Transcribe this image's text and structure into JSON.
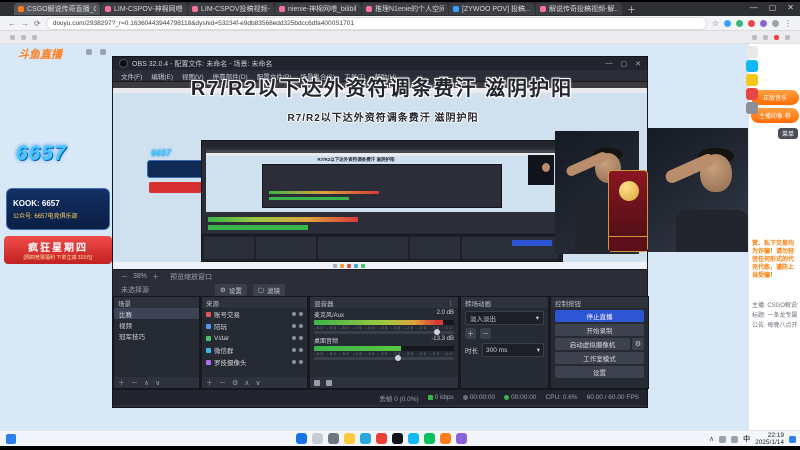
{
  "colors": {
    "douyu_orange": "#ff7c19",
    "bilibili_pink": "#fb7299",
    "tab_blue": "#3aa0ff",
    "obs_bg": "#2b2e38",
    "accent_blue": "#2e55d4",
    "banner_red": "#e23b3b",
    "meter_green": "#3bb54a",
    "meter_red": "#d83a3a",
    "page_blue": "#d9e8f6"
  },
  "icons": {
    "minimize": "—",
    "maximize": "▢",
    "close": "✕",
    "back": "←",
    "forward": "→",
    "reload": "⟳",
    "star": "☆",
    "more": "⋮",
    "caret": "▾",
    "plus": "＋",
    "minus": "－",
    "up": "∧",
    "down": "∨",
    "gear": "⚙"
  },
  "browser": {
    "tabs": [
      {
        "label": "CSGO解说传奇直播_CS...",
        "color": "#ff7c19"
      },
      {
        "label": "LIM-CSPOV-神棉网喂-L...",
        "color": "#fb7299"
      },
      {
        "label": "LIM-CSPOV投稿视频-L...",
        "color": "#fb7299"
      },
      {
        "label": "nienie-神棉网喂_bilibili",
        "color": "#fb7299"
      },
      {
        "label": "推理N1enie的个人空间...",
        "color": "#fb7299"
      },
      {
        "label": "[ZYWOO POV] 投稿...",
        "color": "#3aa0ff"
      },
      {
        "label": "解说传奇投稿视频-解...",
        "color": "#fb7299"
      }
    ],
    "url": "douyu.com/2938297?_r=0.16360443944798118&dyshid=53234f-e9db83568edd325bdcc6dfa4000S1701"
  },
  "site": {
    "logo": "斗鱼直播"
  },
  "branding": {
    "logo": "6657",
    "line1": "KOOK: 6657",
    "line2": "公众号: 6657电竞俱乐部",
    "banner": "疯狂星期四",
    "banner_sub": "[周四竞猜福利 下单立减 315元]"
  },
  "overlay": {
    "text": "R7/R2以下达外资符调条费汗 滋阴护阳"
  },
  "obs": {
    "title": "OBS 32.0.4 - 配置文件: 未命名 - 场景: 未命名",
    "menu": [
      "文件(F)",
      "编辑(E)",
      "视图(V)",
      "停靠部件(D)",
      "配置文件(P)",
      "场景集合(S)",
      "工具(T)",
      "帮助(H)"
    ],
    "toolbar": {
      "zoom": "38%",
      "zoom_label": "预览缩放窗口",
      "no_source": "未选择源",
      "settings": "设置",
      "filters": "滤镜"
    },
    "scenes": {
      "title": "场景",
      "items": [
        "比赛",
        "视频",
        "冠军技巧"
      ]
    },
    "sources": {
      "title": "来源",
      "items": [
        "账号交易",
        "陪玩",
        "Vstar",
        "微信群",
        "罗技摄像头"
      ]
    },
    "mixer": {
      "title": "混音器",
      "scale_text": "-60 -55 -50 -45 -40 -35 -30 -25 -20 -15 -10 -5 0",
      "channels": [
        {
          "name": "麦克风/Aux",
          "db": "2.0 dB",
          "level": 0.92
        },
        {
          "name": "桌面音频",
          "db": "-13.3 dB",
          "level": 0.62
        }
      ]
    },
    "transitions": {
      "title": "转场动画",
      "current": "淡入淡出",
      "duration_label": "时长",
      "duration": "300 ms"
    },
    "controls": {
      "title": "控制按钮",
      "buttons": [
        "停止直播",
        "开始录制",
        "启动虚拟摄像机",
        "工作室模式",
        "设置"
      ]
    },
    "status": {
      "dropped": "丢帧 0 (0.0%)",
      "bitrate": "0 kbps",
      "rec": "00:00:00",
      "live": "00:00:00",
      "cpu": "CPU: 0.6%",
      "fps": "60.00 / 60.00 FPS"
    }
  },
  "chat": {
    "pills": [
      "正版音乐",
      "主播印象·荐"
    ],
    "menu": "菜单",
    "warning": "赏、私下交易均为诈骗！请勿轻信任何形式的代充代练，谨防上当受骗！",
    "lines": [
      "主播: CSGO解说传奇",
      "标题: 一条龙专属直播间",
      "公告: 每晚八点开播"
    ]
  },
  "taskbar": {
    "ime": "中",
    "time": "22:19",
    "date": "2025/1/14"
  }
}
